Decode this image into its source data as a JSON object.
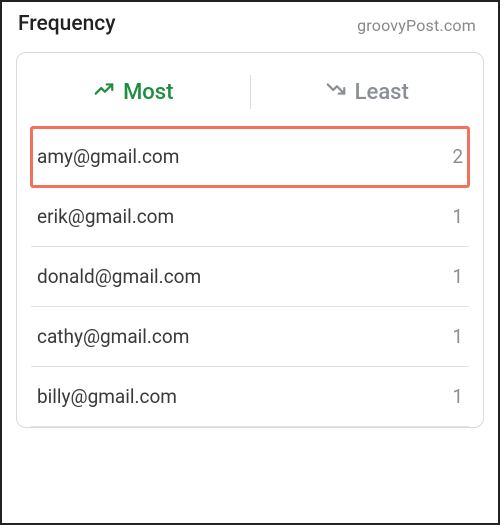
{
  "watermark": "groovyPost.com",
  "header": {
    "title": "Frequency"
  },
  "tabs": {
    "most": {
      "label": "Most",
      "active": true
    },
    "least": {
      "label": "Least",
      "active": false
    }
  },
  "list": {
    "items": [
      {
        "email": "amy@gmail.com",
        "count": "2",
        "highlighted": true
      },
      {
        "email": "erik@gmail.com",
        "count": "1",
        "highlighted": false
      },
      {
        "email": "donald@gmail.com",
        "count": "1",
        "highlighted": false
      },
      {
        "email": "cathy@gmail.com",
        "count": "1",
        "highlighted": false
      },
      {
        "email": "billy@gmail.com",
        "count": "1",
        "highlighted": false
      }
    ]
  }
}
